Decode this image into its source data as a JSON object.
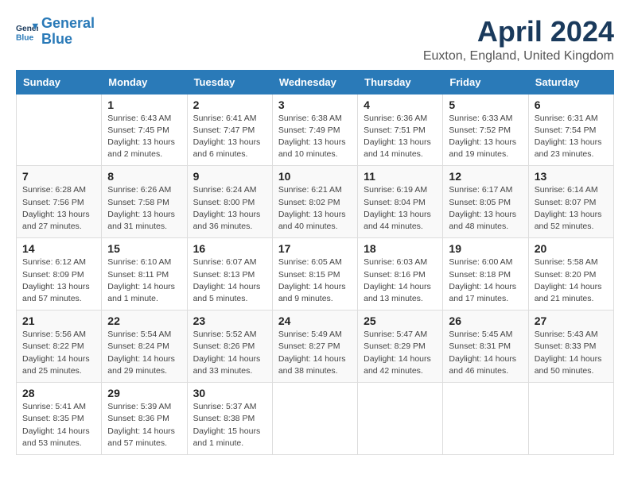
{
  "logo": {
    "line1": "General",
    "line2": "Blue"
  },
  "title": "April 2024",
  "location": "Euxton, England, United Kingdom",
  "days_of_week": [
    "Sunday",
    "Monday",
    "Tuesday",
    "Wednesday",
    "Thursday",
    "Friday",
    "Saturday"
  ],
  "weeks": [
    [
      {
        "day": "",
        "sunrise": "",
        "sunset": "",
        "daylight": ""
      },
      {
        "day": "1",
        "sunrise": "Sunrise: 6:43 AM",
        "sunset": "Sunset: 7:45 PM",
        "daylight": "Daylight: 13 hours and 2 minutes."
      },
      {
        "day": "2",
        "sunrise": "Sunrise: 6:41 AM",
        "sunset": "Sunset: 7:47 PM",
        "daylight": "Daylight: 13 hours and 6 minutes."
      },
      {
        "day": "3",
        "sunrise": "Sunrise: 6:38 AM",
        "sunset": "Sunset: 7:49 PM",
        "daylight": "Daylight: 13 hours and 10 minutes."
      },
      {
        "day": "4",
        "sunrise": "Sunrise: 6:36 AM",
        "sunset": "Sunset: 7:51 PM",
        "daylight": "Daylight: 13 hours and 14 minutes."
      },
      {
        "day": "5",
        "sunrise": "Sunrise: 6:33 AM",
        "sunset": "Sunset: 7:52 PM",
        "daylight": "Daylight: 13 hours and 19 minutes."
      },
      {
        "day": "6",
        "sunrise": "Sunrise: 6:31 AM",
        "sunset": "Sunset: 7:54 PM",
        "daylight": "Daylight: 13 hours and 23 minutes."
      }
    ],
    [
      {
        "day": "7",
        "sunrise": "Sunrise: 6:28 AM",
        "sunset": "Sunset: 7:56 PM",
        "daylight": "Daylight: 13 hours and 27 minutes."
      },
      {
        "day": "8",
        "sunrise": "Sunrise: 6:26 AM",
        "sunset": "Sunset: 7:58 PM",
        "daylight": "Daylight: 13 hours and 31 minutes."
      },
      {
        "day": "9",
        "sunrise": "Sunrise: 6:24 AM",
        "sunset": "Sunset: 8:00 PM",
        "daylight": "Daylight: 13 hours and 36 minutes."
      },
      {
        "day": "10",
        "sunrise": "Sunrise: 6:21 AM",
        "sunset": "Sunset: 8:02 PM",
        "daylight": "Daylight: 13 hours and 40 minutes."
      },
      {
        "day": "11",
        "sunrise": "Sunrise: 6:19 AM",
        "sunset": "Sunset: 8:04 PM",
        "daylight": "Daylight: 13 hours and 44 minutes."
      },
      {
        "day": "12",
        "sunrise": "Sunrise: 6:17 AM",
        "sunset": "Sunset: 8:05 PM",
        "daylight": "Daylight: 13 hours and 48 minutes."
      },
      {
        "day": "13",
        "sunrise": "Sunrise: 6:14 AM",
        "sunset": "Sunset: 8:07 PM",
        "daylight": "Daylight: 13 hours and 52 minutes."
      }
    ],
    [
      {
        "day": "14",
        "sunrise": "Sunrise: 6:12 AM",
        "sunset": "Sunset: 8:09 PM",
        "daylight": "Daylight: 13 hours and 57 minutes."
      },
      {
        "day": "15",
        "sunrise": "Sunrise: 6:10 AM",
        "sunset": "Sunset: 8:11 PM",
        "daylight": "Daylight: 14 hours and 1 minute."
      },
      {
        "day": "16",
        "sunrise": "Sunrise: 6:07 AM",
        "sunset": "Sunset: 8:13 PM",
        "daylight": "Daylight: 14 hours and 5 minutes."
      },
      {
        "day": "17",
        "sunrise": "Sunrise: 6:05 AM",
        "sunset": "Sunset: 8:15 PM",
        "daylight": "Daylight: 14 hours and 9 minutes."
      },
      {
        "day": "18",
        "sunrise": "Sunrise: 6:03 AM",
        "sunset": "Sunset: 8:16 PM",
        "daylight": "Daylight: 14 hours and 13 minutes."
      },
      {
        "day": "19",
        "sunrise": "Sunrise: 6:00 AM",
        "sunset": "Sunset: 8:18 PM",
        "daylight": "Daylight: 14 hours and 17 minutes."
      },
      {
        "day": "20",
        "sunrise": "Sunrise: 5:58 AM",
        "sunset": "Sunset: 8:20 PM",
        "daylight": "Daylight: 14 hours and 21 minutes."
      }
    ],
    [
      {
        "day": "21",
        "sunrise": "Sunrise: 5:56 AM",
        "sunset": "Sunset: 8:22 PM",
        "daylight": "Daylight: 14 hours and 25 minutes."
      },
      {
        "day": "22",
        "sunrise": "Sunrise: 5:54 AM",
        "sunset": "Sunset: 8:24 PM",
        "daylight": "Daylight: 14 hours and 29 minutes."
      },
      {
        "day": "23",
        "sunrise": "Sunrise: 5:52 AM",
        "sunset": "Sunset: 8:26 PM",
        "daylight": "Daylight: 14 hours and 33 minutes."
      },
      {
        "day": "24",
        "sunrise": "Sunrise: 5:49 AM",
        "sunset": "Sunset: 8:27 PM",
        "daylight": "Daylight: 14 hours and 38 minutes."
      },
      {
        "day": "25",
        "sunrise": "Sunrise: 5:47 AM",
        "sunset": "Sunset: 8:29 PM",
        "daylight": "Daylight: 14 hours and 42 minutes."
      },
      {
        "day": "26",
        "sunrise": "Sunrise: 5:45 AM",
        "sunset": "Sunset: 8:31 PM",
        "daylight": "Daylight: 14 hours and 46 minutes."
      },
      {
        "day": "27",
        "sunrise": "Sunrise: 5:43 AM",
        "sunset": "Sunset: 8:33 PM",
        "daylight": "Daylight: 14 hours and 50 minutes."
      }
    ],
    [
      {
        "day": "28",
        "sunrise": "Sunrise: 5:41 AM",
        "sunset": "Sunset: 8:35 PM",
        "daylight": "Daylight: 14 hours and 53 minutes."
      },
      {
        "day": "29",
        "sunrise": "Sunrise: 5:39 AM",
        "sunset": "Sunset: 8:36 PM",
        "daylight": "Daylight: 14 hours and 57 minutes."
      },
      {
        "day": "30",
        "sunrise": "Sunrise: 5:37 AM",
        "sunset": "Sunset: 8:38 PM",
        "daylight": "Daylight: 15 hours and 1 minute."
      },
      {
        "day": "",
        "sunrise": "",
        "sunset": "",
        "daylight": ""
      },
      {
        "day": "",
        "sunrise": "",
        "sunset": "",
        "daylight": ""
      },
      {
        "day": "",
        "sunrise": "",
        "sunset": "",
        "daylight": ""
      },
      {
        "day": "",
        "sunrise": "",
        "sunset": "",
        "daylight": ""
      }
    ]
  ]
}
